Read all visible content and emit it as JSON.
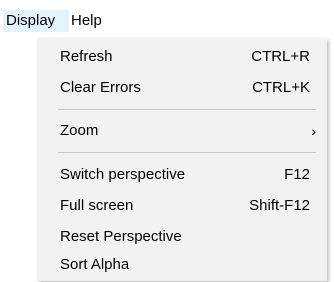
{
  "menubar": {
    "items": [
      {
        "label": "Display"
      },
      {
        "label": "Help"
      }
    ]
  },
  "dropdown": {
    "items": [
      {
        "label": "Refresh",
        "shortcut": "CTRL+R"
      },
      {
        "label": "Clear Errors",
        "shortcut": "CTRL+K"
      },
      {
        "label": "Zoom",
        "submenu_icon": "chevron-right-icon",
        "arrow": "›"
      },
      {
        "label": "Switch perspective",
        "shortcut": "F12"
      },
      {
        "label": "Full screen",
        "shortcut": "Shift-F12"
      },
      {
        "label": "Reset Perspective"
      },
      {
        "label": "Sort Alpha"
      }
    ]
  },
  "colors": {
    "menu_background": "#f2f2f2",
    "active_menu_highlight": "#e5f3ff",
    "separator": "#c9c9c9"
  }
}
